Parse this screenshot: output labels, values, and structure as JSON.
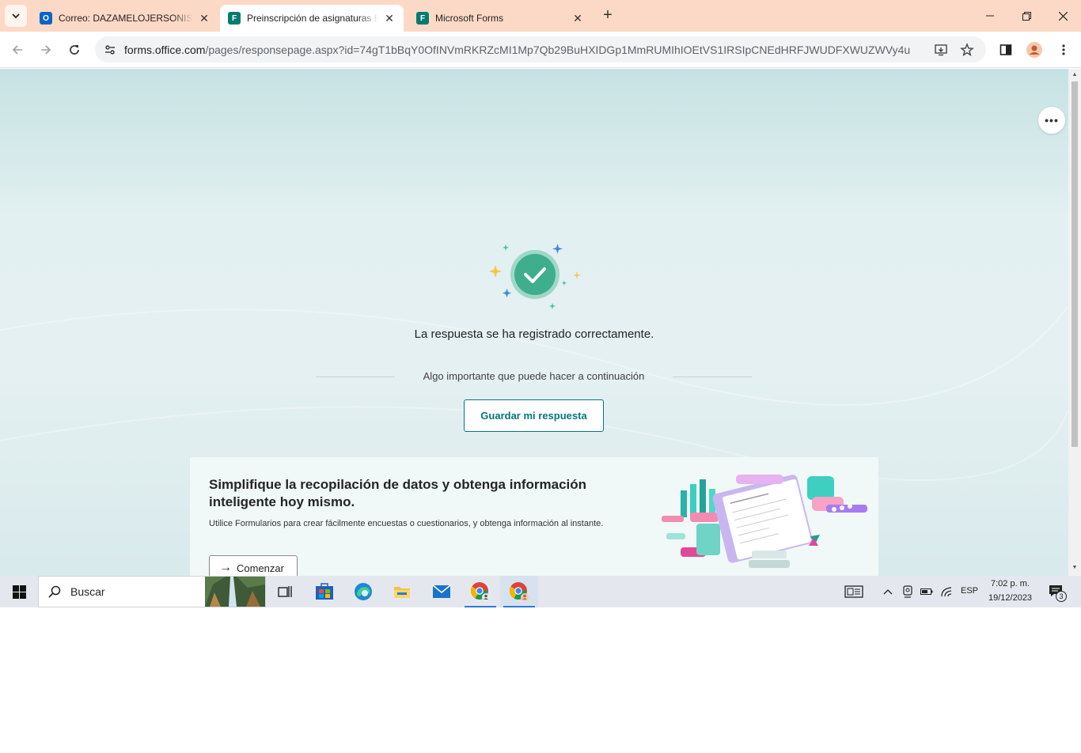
{
  "browser": {
    "tabs": [
      {
        "title": "Correo: DAZAMELOJERSONISRA",
        "icon": "outlook-icon",
        "active": false
      },
      {
        "title": "Preinscripción de asignaturas El",
        "icon": "forms-icon",
        "active": true
      },
      {
        "title": "Microsoft Forms",
        "icon": "forms-icon",
        "active": false
      }
    ],
    "url_host": "forms.office.com",
    "url_rest": "/pages/responsepage.aspx?id=74gT1bBqY0OfINVmRKRZcMI1Mp7Qb29BuHXIDGp1MmRUMIhIOEtVS1IRSIpCNEdHRFJWUDFXWUZWVy4u"
  },
  "page": {
    "success_message": "La respuesta se ha registrado correctamente.",
    "next_step_label": "Algo importante que puede hacer a continuación",
    "save_button": "Guardar mi respuesta",
    "more_button": "•••",
    "promo": {
      "heading": "Simplifique la recopilación de datos y obtenga información inteligente hoy mismo.",
      "body": "Utilice Formularios para crear fácilmente encuestas o cuestionarios, y obtenga información al instante.",
      "cta": "Comenzar"
    }
  },
  "taskbar": {
    "search_placeholder": "Buscar",
    "language": "ESP",
    "time": "7:02 p. m.",
    "date": "19/12/2023",
    "notification_count": "3"
  },
  "colors": {
    "tabstrip": "#fcd9c6",
    "accent_teal": "#03787c",
    "success_green": "#3fae8c"
  }
}
